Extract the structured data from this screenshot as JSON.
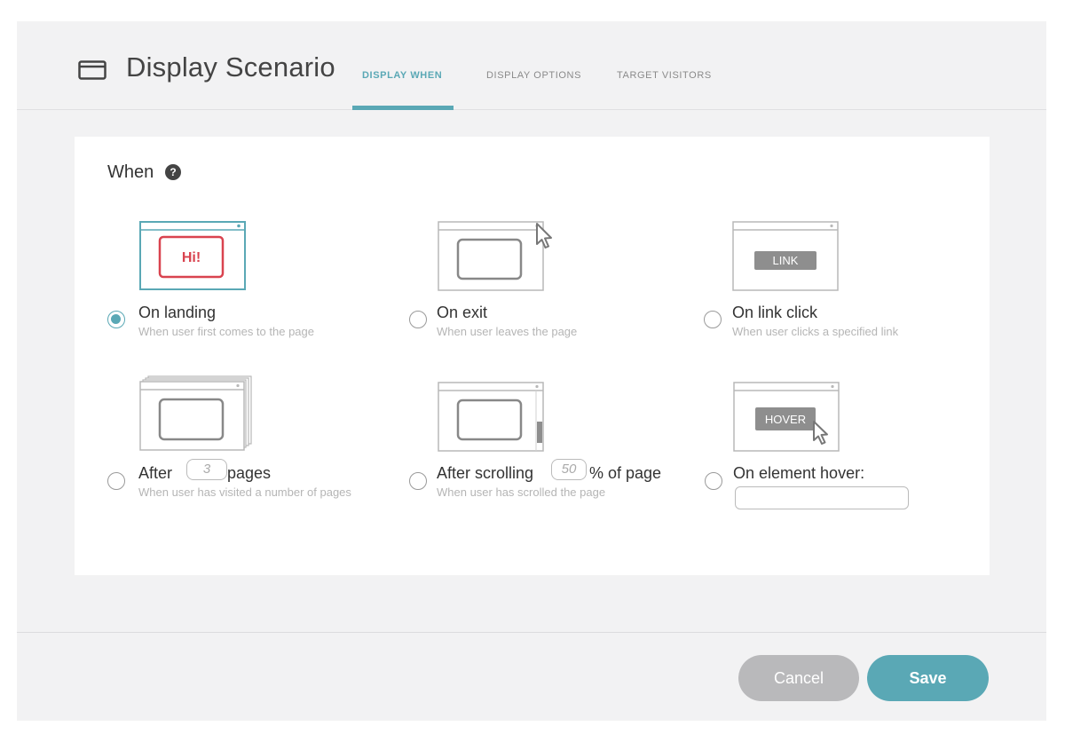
{
  "header": {
    "title": "Display Scenario",
    "tabs": [
      {
        "label": "DISPLAY WHEN",
        "active": true
      },
      {
        "label": "DISPLAY OPTIONS",
        "active": false
      },
      {
        "label": "TARGET VISITORS",
        "active": false
      }
    ]
  },
  "section": {
    "label": "When",
    "help_icon": "?"
  },
  "options": [
    {
      "id": "on-landing",
      "title": "On landing",
      "description": "When user first comes to the page",
      "checked": true,
      "illustration_text": "Hi!"
    },
    {
      "id": "on-exit",
      "title": "On exit",
      "description": "When user leaves the page",
      "checked": false
    },
    {
      "id": "on-link-click",
      "title": "On link click",
      "description": "When user clicks a specified link",
      "checked": false,
      "illustration_text": "LINK"
    },
    {
      "id": "after-pages",
      "title_prefix": "After",
      "title_suffix": "pages",
      "input_value": "3",
      "description": "When user has visited a number of pages",
      "checked": false
    },
    {
      "id": "after-scrolling",
      "title_prefix": "After scrolling",
      "title_suffix": "% of page",
      "input_value": "50",
      "description": "When user has scrolled the page",
      "checked": false
    },
    {
      "id": "on-element-hover",
      "title": "On element hover:",
      "input_value": "",
      "checked": false,
      "illustration_text": "HOVER"
    }
  ],
  "footer": {
    "cancel_label": "Cancel",
    "save_label": "Save"
  },
  "colors": {
    "accent": "#5aa8b5",
    "landing_red": "#d9434f",
    "cancel_gray": "#b9b9bb"
  }
}
